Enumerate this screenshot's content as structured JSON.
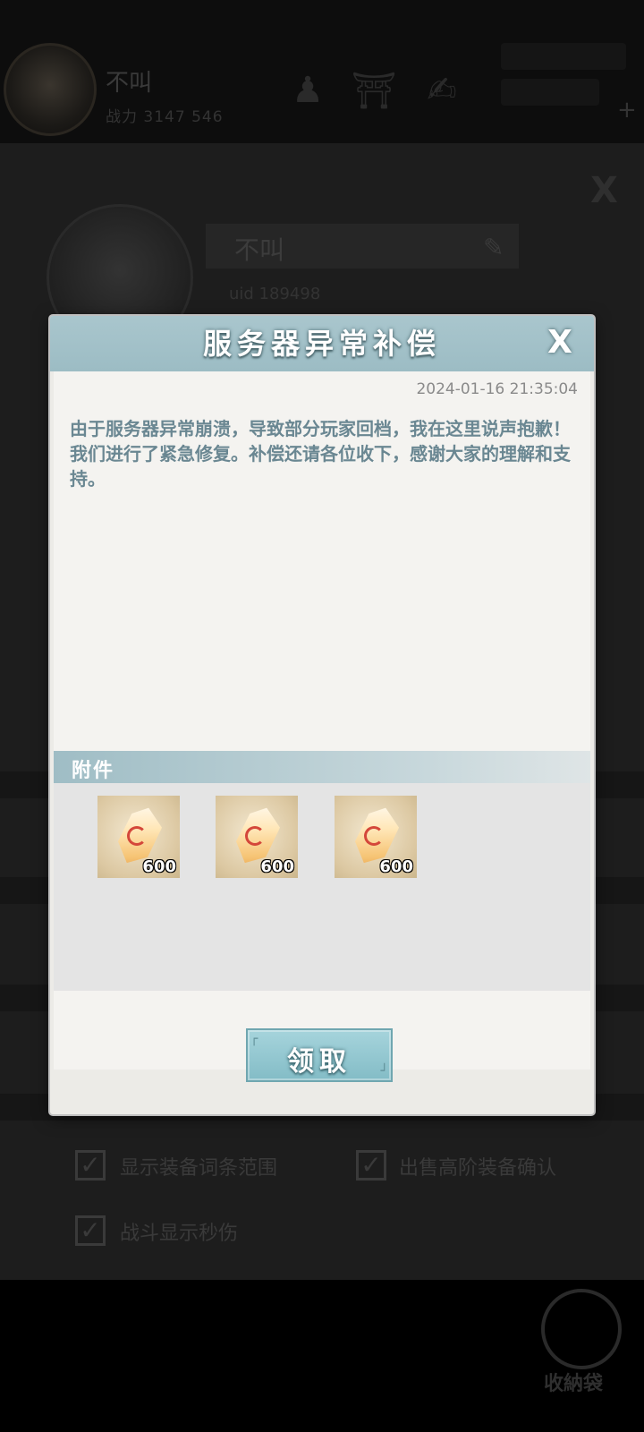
{
  "background": {
    "player_name": "不叫",
    "power_text": "战力 3147 546",
    "profile_name": "不叫",
    "uid_text": "uid 189498",
    "settings": [
      {
        "label": "显示装备词条范围"
      },
      {
        "label": "出售高阶装备确认"
      },
      {
        "label": "战斗显示秒伤"
      }
    ],
    "corner_label": "收納袋"
  },
  "dialog": {
    "title": "服务器异常补偿",
    "close_label": "X",
    "date": "2024-01-16 21:35:04",
    "message_line1": "由于服务器异常崩溃，导致部分玩家回档，我在这里说声抱歉！",
    "message_line2": "我们进行了紧急修复。补偿还请各位收下，感谢大家的理解和支持。",
    "attachments_label": "附件",
    "attachments": [
      {
        "icon": "crystal-icon",
        "count": "600"
      },
      {
        "icon": "crystal-icon",
        "count": "600"
      },
      {
        "icon": "crystal-icon",
        "count": "600"
      }
    ],
    "claim_label": "领取"
  }
}
